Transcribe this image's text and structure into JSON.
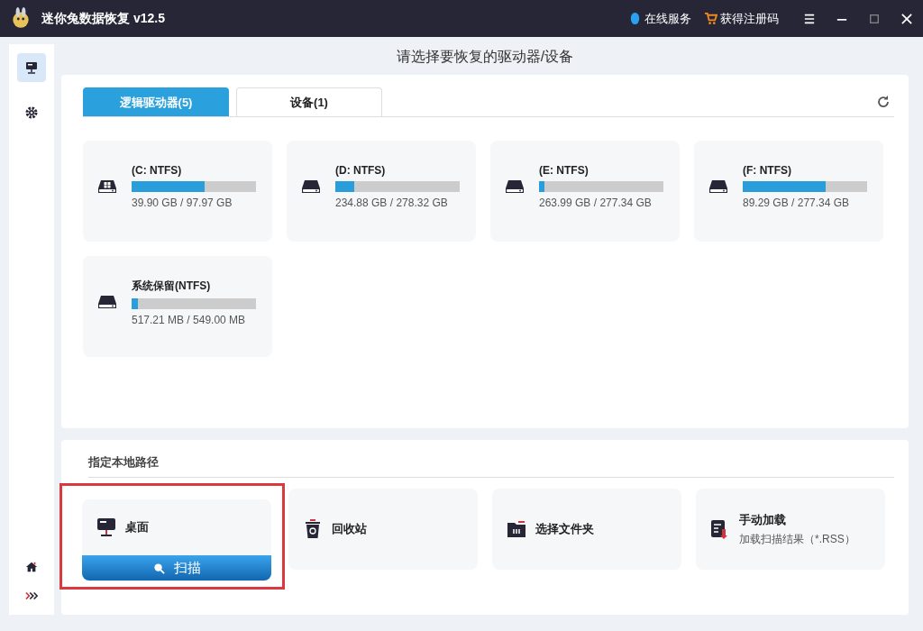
{
  "window": {
    "title": "迷你兔数据恢复 v12.5",
    "links": [
      {
        "kind": "service",
        "label": "在线服务"
      },
      {
        "kind": "cart",
        "label": "获得注册码"
      }
    ]
  },
  "sidebar": {
    "items": [
      {
        "kind": "drives",
        "selected": true
      },
      {
        "kind": "settings",
        "selected": false
      }
    ],
    "bottom_items": [
      {
        "kind": "home"
      },
      {
        "kind": "expand"
      }
    ]
  },
  "heading": "请选择要恢复的驱动器/设备",
  "tabs": [
    {
      "label": "逻辑驱动器(5)",
      "selected": true
    },
    {
      "label": "设备(1)",
      "selected": false
    }
  ],
  "drives": [
    {
      "kind": "system",
      "name": "(C: NTFS)",
      "level": 0.59,
      "usage": "39.90 GB / 97.97 GB"
    },
    {
      "kind": "disk",
      "name": "(D: NTFS)",
      "level": 0.15,
      "usage": "234.88 GB / 278.32 GB"
    },
    {
      "kind": "disk",
      "name": "(E: NTFS)",
      "level": 0.04,
      "usage": "263.99 GB / 277.34 GB"
    },
    {
      "kind": "disk",
      "name": "(F: NTFS)",
      "level": 0.67,
      "usage": "89.29 GB / 277.34 GB"
    },
    {
      "kind": "disk",
      "name": "系统保留(NTFS)",
      "level": 0.05,
      "usage": "517.21 MB / 549.00 MB"
    }
  ],
  "local_path": {
    "title": "指定本地路径",
    "items": [
      {
        "kind": "desktop",
        "label": "桌面",
        "selected": true,
        "action": "扫描"
      },
      {
        "kind": "recycle",
        "label": "回收站",
        "selected": false
      },
      {
        "kind": "folder",
        "label": "选择文件夹",
        "selected": false
      },
      {
        "kind": "load",
        "label": "手动加载",
        "selected": false,
        "hint": "加载扫描结果（*.RSS）"
      }
    ]
  }
}
